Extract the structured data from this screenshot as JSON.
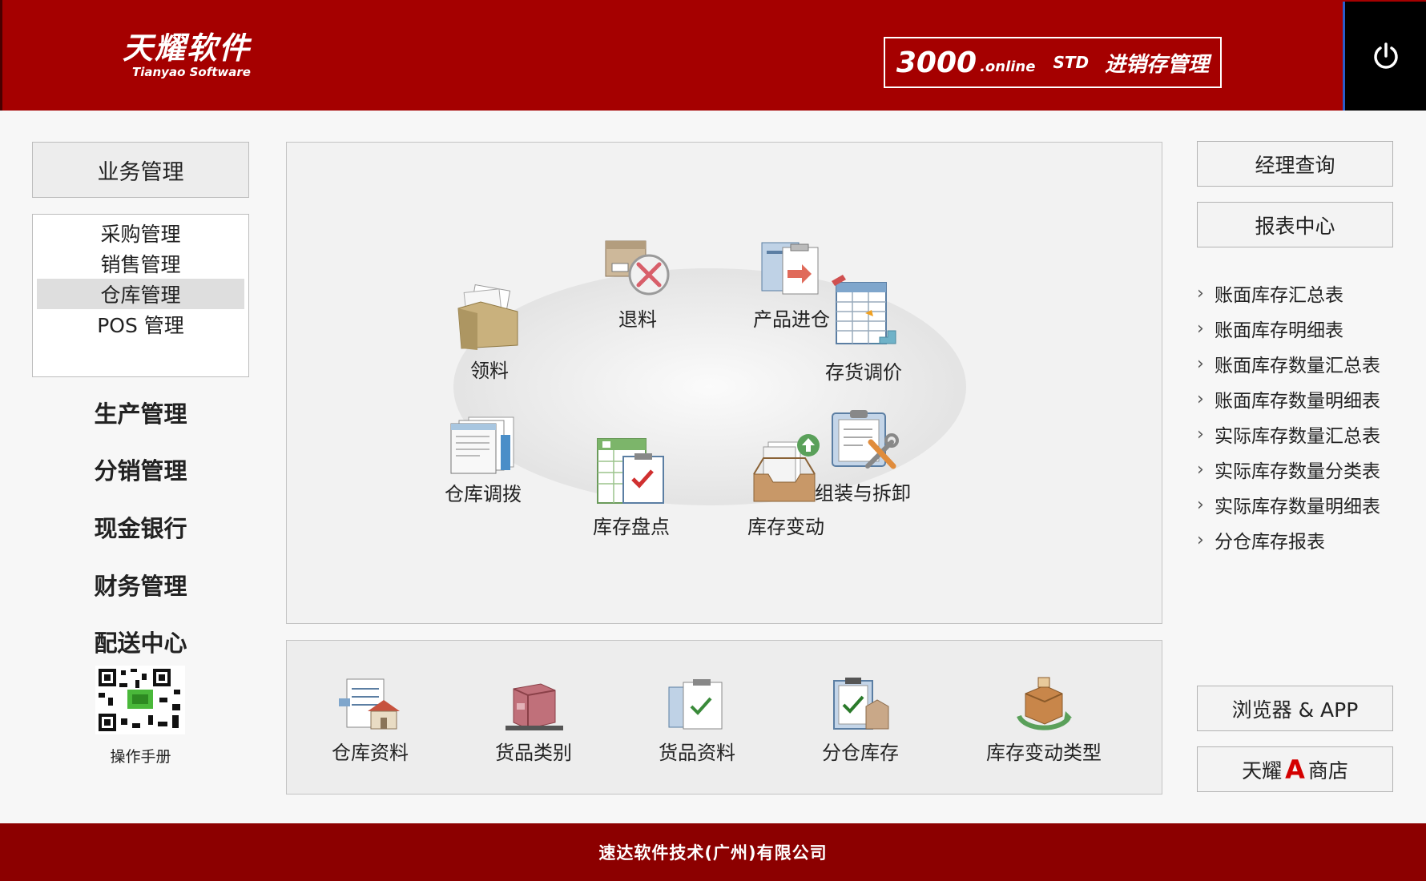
{
  "header": {
    "logo_cn": "天耀软件",
    "logo_en": "Tianyao Software",
    "product_number": "3000",
    "product_online": ".online",
    "product_edition": "STD",
    "product_name": "进销存管理",
    "power_icon": "power-icon"
  },
  "sidebar": {
    "title": "业务管理",
    "sub_items": [
      {
        "label": "采购管理",
        "active": false
      },
      {
        "label": "销售管理",
        "active": false
      },
      {
        "label": "仓库管理",
        "active": true
      },
      {
        "label": "POS 管理",
        "active": false
      }
    ],
    "nav_items": [
      {
        "label": "生产管理"
      },
      {
        "label": "分销管理"
      },
      {
        "label": "现金银行"
      },
      {
        "label": "财务管理"
      },
      {
        "label": "配送中心"
      }
    ],
    "qr_icon": "qr-code-icon",
    "manual_label": "操作手册"
  },
  "main": {
    "modules": [
      {
        "label": "退料",
        "icon": "return-box-icon"
      },
      {
        "label": "产品进仓",
        "icon": "product-in-icon"
      },
      {
        "label": "领料",
        "icon": "folder-icon"
      },
      {
        "label": "存货调价",
        "icon": "spreadsheet-price-icon"
      },
      {
        "label": "仓库调拨",
        "icon": "transfer-docs-icon"
      },
      {
        "label": "组装与拆卸",
        "icon": "clipboard-tools-icon"
      },
      {
        "label": "库存盘点",
        "icon": "inventory-check-icon"
      },
      {
        "label": "库存变动",
        "icon": "inbox-upload-icon"
      }
    ]
  },
  "bottom": {
    "modules": [
      {
        "label": "仓库资料",
        "icon": "warehouse-doc-icon"
      },
      {
        "label": "货品类别",
        "icon": "goods-box-icon"
      },
      {
        "label": "货品资料",
        "icon": "goods-doc-icon"
      },
      {
        "label": "分仓库存",
        "icon": "branch-stock-icon"
      },
      {
        "label": "库存变动类型",
        "icon": "stock-change-type-icon"
      }
    ]
  },
  "right": {
    "manager_query": "经理查询",
    "report_center": "报表中心",
    "reports": [
      "账面库存汇总表",
      "账面库存明细表",
      "账面库存数量汇总表",
      "账面库存数量明细表",
      "实际库存数量汇总表",
      "实际库存数量分类表",
      "实际库存数量明细表",
      "分仓库存报表"
    ],
    "browser_app": "浏览器 & APP",
    "shop_prefix": "天耀",
    "shop_a": "A",
    "shop_suffix": "商店"
  },
  "footer": {
    "company": "速达软件技术(广州)有限公司"
  },
  "colors": {
    "header_bg": "#a50000",
    "footer_bg": "#8c0000",
    "accent_red": "#d40000"
  }
}
